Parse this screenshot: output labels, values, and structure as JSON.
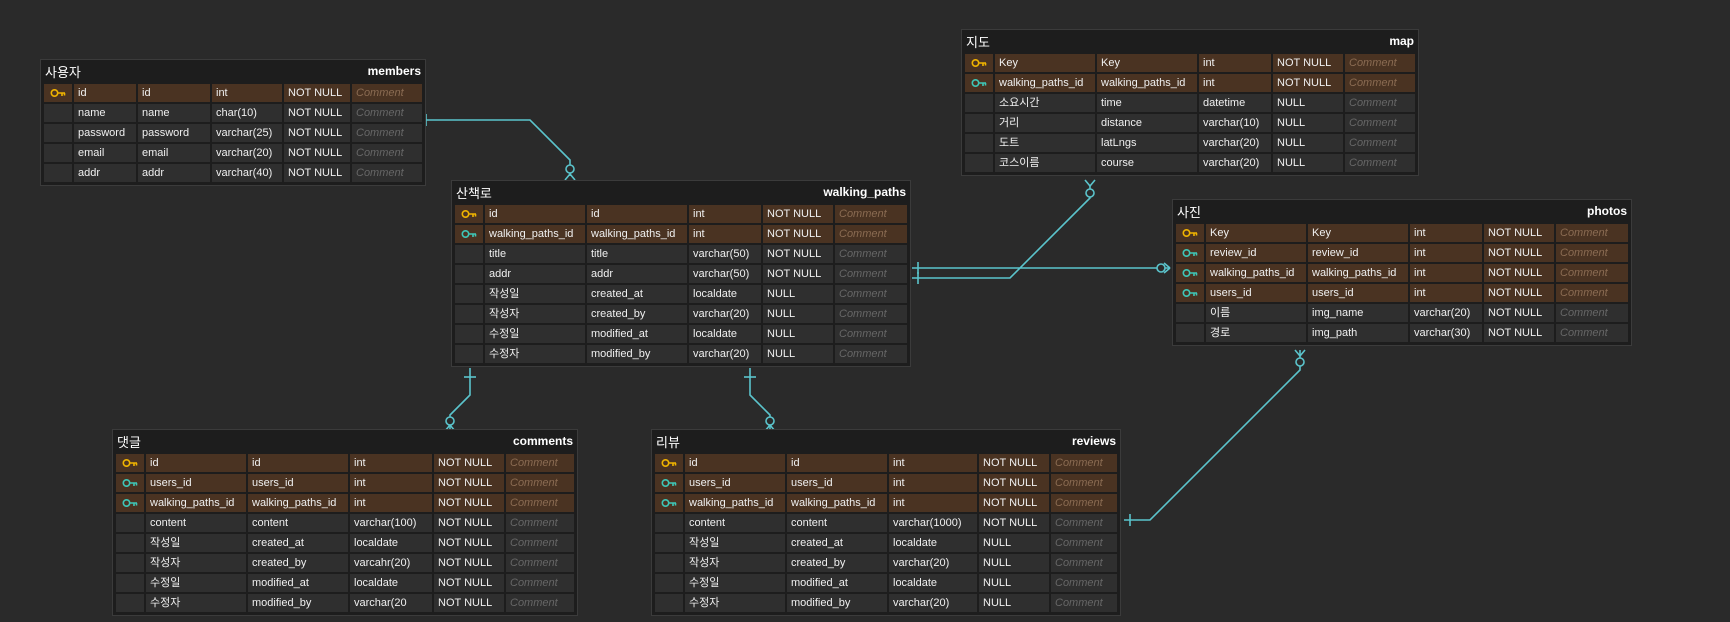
{
  "comment_placeholder": "Comment",
  "colors": {
    "background": "#2a2a2a",
    "line": "#5bc4cc",
    "pk": "#f0b400",
    "fk": "#3ec7b8",
    "key_row": "#4a3322"
  },
  "tables": {
    "members": {
      "title": "사용자",
      "name": "members",
      "rows": [
        {
          "key": "pk",
          "logical": "id",
          "physical": "id",
          "type": "int",
          "null": "NOT NULL"
        },
        {
          "key": "",
          "logical": "name",
          "physical": "name",
          "type": "char(10)",
          "null": "NOT NULL"
        },
        {
          "key": "",
          "logical": "password",
          "physical": "password",
          "type": "varchar(25)",
          "null": "NOT NULL"
        },
        {
          "key": "",
          "logical": "email",
          "physical": "email",
          "type": "varchar(20)",
          "null": "NOT NULL"
        },
        {
          "key": "",
          "logical": "addr",
          "physical": "addr",
          "type": "varchar(40)",
          "null": "NOT NULL"
        }
      ]
    },
    "map": {
      "title": "지도",
      "name": "map",
      "rows": [
        {
          "key": "pk",
          "logical": "Key",
          "physical": "Key",
          "type": "int",
          "null": "NOT NULL"
        },
        {
          "key": "fk",
          "logical": "walking_paths_id",
          "physical": "walking_paths_id",
          "type": "int",
          "null": "NOT NULL"
        },
        {
          "key": "",
          "logical": "소요시간",
          "physical": "time",
          "type": "datetime",
          "null": "NULL"
        },
        {
          "key": "",
          "logical": "거리",
          "physical": "distance",
          "type": "varchar(10)",
          "null": "NULL"
        },
        {
          "key": "",
          "logical": "도트",
          "physical": "latLngs",
          "type": "varchar(20)",
          "null": "NULL"
        },
        {
          "key": "",
          "logical": "코스이름",
          "physical": "course",
          "type": "varchar(20)",
          "null": "NULL"
        }
      ]
    },
    "walking_paths": {
      "title": "산책로",
      "name": "walking_paths",
      "rows": [
        {
          "key": "pk",
          "logical": "id",
          "physical": "id",
          "type": "int",
          "null": "NOT NULL"
        },
        {
          "key": "fk",
          "logical": "walking_paths_id",
          "physical": "walking_paths_id",
          "type": "int",
          "null": "NOT NULL"
        },
        {
          "key": "",
          "logical": "title",
          "physical": "title",
          "type": "varchar(50)",
          "null": "NOT NULL"
        },
        {
          "key": "",
          "logical": "addr",
          "physical": "addr",
          "type": "varchar(50)",
          "null": "NOT NULL"
        },
        {
          "key": "",
          "logical": "작성일",
          "physical": "created_at",
          "type": "localdate",
          "null": "NULL"
        },
        {
          "key": "",
          "logical": "작성자",
          "physical": "created_by",
          "type": "varchar(20)",
          "null": "NULL"
        },
        {
          "key": "",
          "logical": "수정일",
          "physical": "modified_at",
          "type": "localdate",
          "null": "NULL"
        },
        {
          "key": "",
          "logical": "수정자",
          "physical": "modified_by",
          "type": "varchar(20)",
          "null": "NULL"
        }
      ]
    },
    "photos": {
      "title": "사진",
      "name": "photos",
      "rows": [
        {
          "key": "pk",
          "logical": "Key",
          "physical": "Key",
          "type": "int",
          "null": "NOT NULL"
        },
        {
          "key": "fk",
          "logical": "review_id",
          "physical": "review_id",
          "type": "int",
          "null": "NOT NULL"
        },
        {
          "key": "fk",
          "logical": "walking_paths_id",
          "physical": "walking_paths_id",
          "type": "int",
          "null": "NOT NULL"
        },
        {
          "key": "fk",
          "logical": "users_id",
          "physical": "users_id",
          "type": "int",
          "null": "NOT NULL"
        },
        {
          "key": "",
          "logical": "이름",
          "physical": "img_name",
          "type": "varchar(20)",
          "null": "NOT NULL"
        },
        {
          "key": "",
          "logical": "경로",
          "physical": "img_path",
          "type": "varchar(30)",
          "null": "NOT NULL"
        }
      ]
    },
    "comments": {
      "title": "댓글",
      "name": "comments",
      "rows": [
        {
          "key": "pk",
          "logical": "id",
          "physical": "id",
          "type": "int",
          "null": "NOT NULL"
        },
        {
          "key": "fk",
          "logical": "users_id",
          "physical": "users_id",
          "type": "int",
          "null": "NOT NULL"
        },
        {
          "key": "fk",
          "logical": "walking_paths_id",
          "physical": "walking_paths_id",
          "type": "int",
          "null": "NOT NULL"
        },
        {
          "key": "",
          "logical": "content",
          "physical": "content",
          "type": "varchar(100)",
          "null": "NOT NULL"
        },
        {
          "key": "",
          "logical": "작성일",
          "physical": "created_at",
          "type": "localdate",
          "null": "NOT NULL"
        },
        {
          "key": "",
          "logical": "작성자",
          "physical": "created_by",
          "type": "varcahr(20)",
          "null": "NOT NULL"
        },
        {
          "key": "",
          "logical": "수정일",
          "physical": "modified_at",
          "type": "localdate",
          "null": "NOT NULL"
        },
        {
          "key": "",
          "logical": "수정자",
          "physical": "modified_by",
          "type": "varchar(20",
          "null": "NOT NULL"
        }
      ]
    },
    "reviews": {
      "title": "리뷰",
      "name": "reviews",
      "rows": [
        {
          "key": "pk",
          "logical": "id",
          "physical": "id",
          "type": "int",
          "null": "NOT NULL"
        },
        {
          "key": "fk",
          "logical": "users_id",
          "physical": "users_id",
          "type": "int",
          "null": "NOT NULL"
        },
        {
          "key": "fk",
          "logical": "walking_paths_id",
          "physical": "walking_paths_id",
          "type": "int",
          "null": "NOT NULL"
        },
        {
          "key": "",
          "logical": "content",
          "physical": "content",
          "type": "varchar(1000)",
          "null": "NOT NULL"
        },
        {
          "key": "",
          "logical": "작성일",
          "physical": "created_at",
          "type": "localdate",
          "null": "NULL"
        },
        {
          "key": "",
          "logical": "작성자",
          "physical": "created_by",
          "type": "varchar(20)",
          "null": "NULL"
        },
        {
          "key": "",
          "logical": "수정일",
          "physical": "modified_at",
          "type": "localdate",
          "null": "NULL"
        },
        {
          "key": "",
          "logical": "수정자",
          "physical": "modified_by",
          "type": "varchar(20)",
          "null": "NULL"
        }
      ]
    }
  }
}
